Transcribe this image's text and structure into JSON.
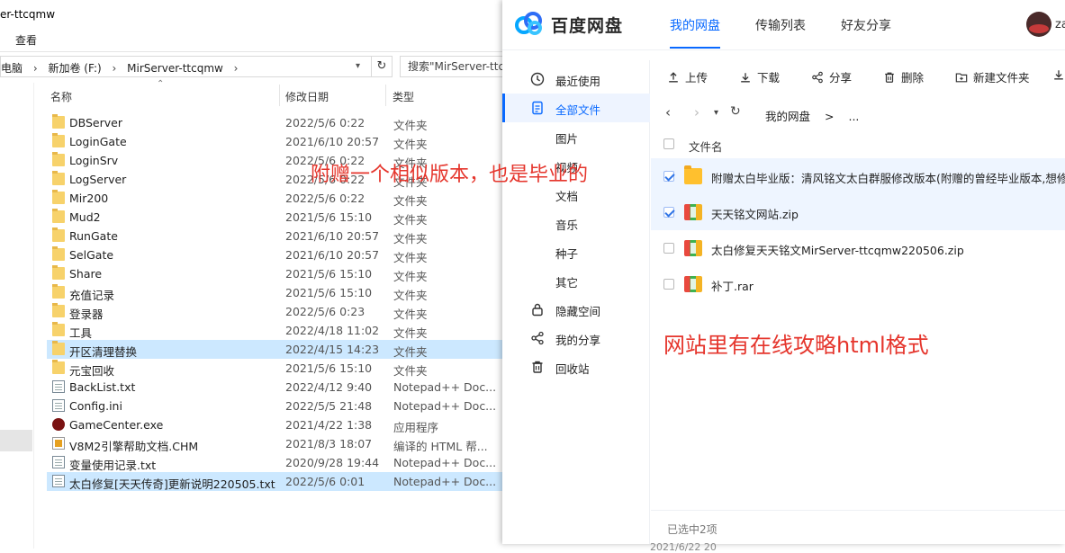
{
  "explorer": {
    "title": "er-ttcqmw",
    "ribbon_tab": "查看",
    "address": [
      "电脑",
      "›",
      "新加卷 (F:)",
      "›",
      "MirServer-ttcqmw",
      "›"
    ],
    "search_placeholder": "搜索\"MirServer-ttc",
    "columns": {
      "name": "名称",
      "date": "修改日期",
      "type": "类型"
    },
    "rows": [
      {
        "name": "DBServer",
        "date": "2022/5/6 0:22",
        "type": "文件夹",
        "icon": "folder"
      },
      {
        "name": "LoginGate",
        "date": "2021/6/10 20:57",
        "type": "文件夹",
        "icon": "folder"
      },
      {
        "name": "LoginSrv",
        "date": "2022/5/6 0:22",
        "type": "文件夹",
        "icon": "folder"
      },
      {
        "name": "LogServer",
        "date": "2022/5/6 0:22",
        "type": "文件夹",
        "icon": "folder"
      },
      {
        "name": "Mir200",
        "date": "2022/5/6 0:22",
        "type": "文件夹",
        "icon": "folder"
      },
      {
        "name": "Mud2",
        "date": "2021/5/6 15:10",
        "type": "文件夹",
        "icon": "folder"
      },
      {
        "name": "RunGate",
        "date": "2021/6/10 20:57",
        "type": "文件夹",
        "icon": "folder"
      },
      {
        "name": "SelGate",
        "date": "2021/6/10 20:57",
        "type": "文件夹",
        "icon": "folder"
      },
      {
        "name": "Share",
        "date": "2021/5/6 15:10",
        "type": "文件夹",
        "icon": "folder"
      },
      {
        "name": "充值记录",
        "date": "2021/5/6 15:10",
        "type": "文件夹",
        "icon": "folder"
      },
      {
        "name": "登录器",
        "date": "2022/5/6 0:23",
        "type": "文件夹",
        "icon": "folder"
      },
      {
        "name": "工具",
        "date": "2022/4/18 11:02",
        "type": "文件夹",
        "icon": "folder"
      },
      {
        "name": "开区清理替换",
        "date": "2022/4/15 14:23",
        "type": "文件夹",
        "icon": "folder",
        "selected": true
      },
      {
        "name": "元宝回收",
        "date": "2021/5/6 15:10",
        "type": "文件夹",
        "icon": "folder"
      },
      {
        "name": "BackList.txt",
        "date": "2022/4/12 9:40",
        "type": "Notepad++ Doc...",
        "icon": "txt"
      },
      {
        "name": "Config.ini",
        "date": "2022/5/5 21:48",
        "type": "Notepad++ Doc...",
        "icon": "txt"
      },
      {
        "name": "GameCenter.exe",
        "date": "2021/4/22 1:38",
        "type": "应用程序",
        "icon": "exe"
      },
      {
        "name": "V8M2引擎帮助文档.CHM",
        "date": "2021/8/3 18:07",
        "type": "编译的 HTML 帮...",
        "icon": "chm"
      },
      {
        "name": "变量使用记录.txt",
        "date": "2020/9/28 19:44",
        "type": "Notepad++ Doc...",
        "icon": "txt"
      },
      {
        "name": "太白修复[天天传奇]更新说明220505.txt",
        "date": "2022/5/6 0:01",
        "type": "Notepad++ Doc...",
        "icon": "txt",
        "selected": true
      }
    ]
  },
  "annotations": {
    "top": "附赠一个相似版本，也是毕业的",
    "bottom": "网站里有在线攻略html格式"
  },
  "baidu": {
    "brand": "百度网盘",
    "tabs": [
      "我的网盘",
      "传输列表",
      "好友分享"
    ],
    "active_tab": 0,
    "user": "za",
    "sidebar": [
      {
        "label": "最近使用",
        "icon": "clock-icon"
      },
      {
        "label": "全部文件",
        "icon": "file-icon",
        "active": true
      },
      {
        "label": "图片",
        "icon": ""
      },
      {
        "label": "视频",
        "icon": ""
      },
      {
        "label": "文档",
        "icon": ""
      },
      {
        "label": "音乐",
        "icon": ""
      },
      {
        "label": "种子",
        "icon": ""
      },
      {
        "label": "其它",
        "icon": ""
      },
      {
        "label": "隐藏空间",
        "icon": "lock-icon"
      },
      {
        "label": "我的分享",
        "icon": "share-icon"
      },
      {
        "label": "回收站",
        "icon": "trash-icon"
      }
    ],
    "toolbar": [
      {
        "label": "上传",
        "icon": "upload-icon"
      },
      {
        "label": "下载",
        "icon": "download-icon"
      },
      {
        "label": "分享",
        "icon": "share-icon"
      },
      {
        "label": "删除",
        "icon": "trash-icon"
      },
      {
        "label": "新建文件夹",
        "icon": "new-folder-icon"
      }
    ],
    "breadcrumb": [
      "我的网盘",
      ">",
      "..."
    ],
    "column_header": "文件名",
    "files": [
      {
        "name": "附赠太白毕业版：清风铭文太白群服修改版本(附赠的曾经毕业版本,想修复...",
        "type": "folder",
        "checked": true
      },
      {
        "name": "天天铭文网站.zip",
        "type": "zip",
        "checked": true
      },
      {
        "name": "太白修复天天铭文MirServer-ttcqmw220506.zip",
        "type": "zip",
        "checked": false
      },
      {
        "name": "补丁.rar",
        "type": "zip",
        "checked": false
      }
    ],
    "status": "已选中2项",
    "bottom_strip": "2021/6/22 20"
  },
  "colors": {
    "accent": "#0969ff",
    "annotation": "#e5352c",
    "selection": "#cce8ff"
  }
}
